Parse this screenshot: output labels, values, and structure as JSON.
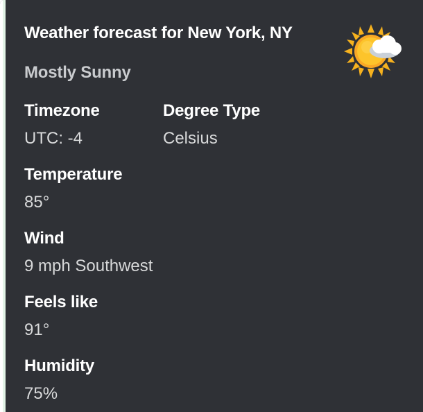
{
  "embed": {
    "title": "Weather forecast for New York, NY",
    "description": "Mostly Sunny",
    "thumbnail_icon": "sun-behind-cloud-icon",
    "accent_color": "#e2f3e6",
    "fields": [
      {
        "name": "Timezone",
        "value": "UTC: -4"
      },
      {
        "name": "Degree Type",
        "value": "Celsius"
      },
      {
        "name": "Temperature",
        "value": "85°"
      },
      {
        "name": "Wind",
        "value": "9 mph Southwest"
      },
      {
        "name": "Feels like",
        "value": "91°"
      },
      {
        "name": "Humidity",
        "value": "75%"
      }
    ]
  }
}
